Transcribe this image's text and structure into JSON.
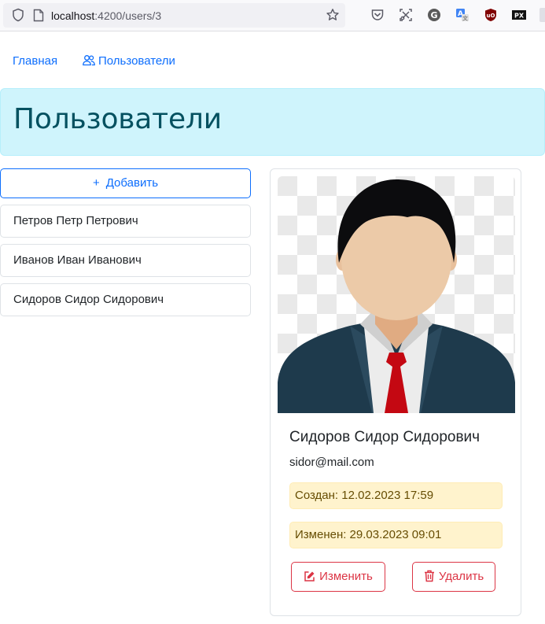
{
  "browser": {
    "url_host": "localhost",
    "url_path": ":4200/users/3"
  },
  "nav": {
    "home": "Главная",
    "users": "Пользователи"
  },
  "banner": {
    "title": "Пользователи"
  },
  "list": {
    "add_label": "Добавить",
    "items": [
      "Петров Петр Петрович",
      "Иванов Иван Иванович",
      "Сидоров Сидор Сидорович"
    ]
  },
  "card": {
    "name": "Сидоров Сидор Сидорович",
    "email": "sidor@mail.com",
    "created": "Создан: 12.02.2023 17:59",
    "updated": "Изменен: 29.03.2023 09:01",
    "edit_label": "Изменить",
    "delete_label": "Удалить"
  },
  "colors": {
    "primary": "#0d6efd",
    "danger": "#dc3545",
    "info_bg": "#cff4fc",
    "warning_bg": "#fff3cd"
  },
  "icons": [
    "shield-icon",
    "page-icon",
    "star-icon",
    "pocket-icon",
    "screenshot-icon",
    "grammarly-icon",
    "translate-icon",
    "ublock-icon",
    "px-icon",
    "users-icon",
    "plus-icon",
    "edit-icon",
    "trash-icon"
  ]
}
